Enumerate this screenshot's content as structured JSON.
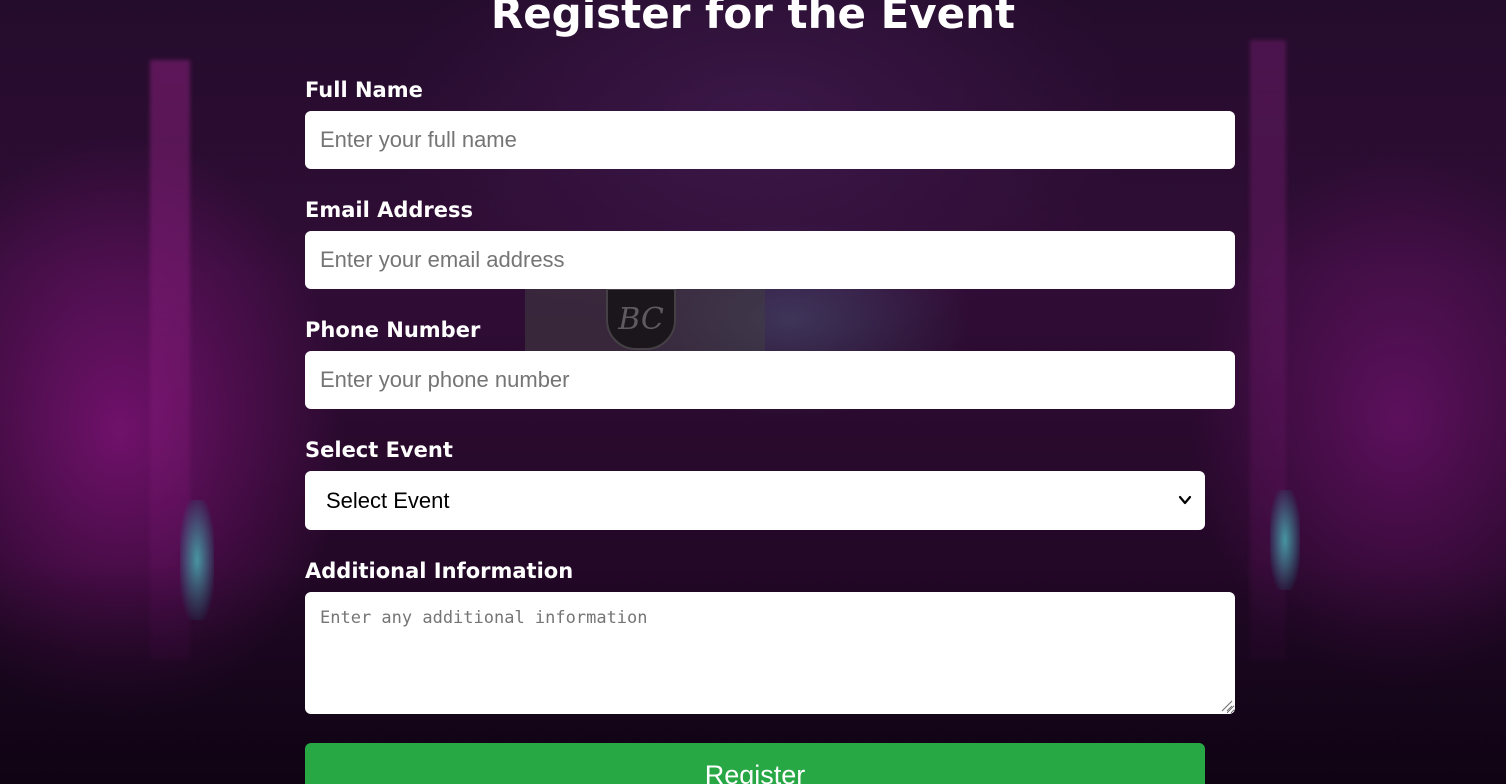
{
  "form": {
    "title": "Register for the Event",
    "full_name": {
      "label": "Full Name",
      "placeholder": "Enter your full name",
      "value": ""
    },
    "email": {
      "label": "Email Address",
      "placeholder": "Enter your email address",
      "value": ""
    },
    "phone": {
      "label": "Phone Number",
      "placeholder": "Enter your phone number",
      "value": ""
    },
    "event": {
      "label": "Select Event",
      "selected": "Select Event"
    },
    "additional": {
      "label": "Additional Information",
      "placeholder": "Enter any additional information",
      "value": ""
    },
    "submit_label": "Register"
  },
  "colors": {
    "submit_button": "#28a745",
    "input_background": "#ffffff",
    "label_text": "#ffffff"
  },
  "icons": {
    "select_chevron": "chevron-down-icon",
    "textarea_resize": "resize-handle-icon",
    "background_crest": "bc-crest-logo"
  },
  "background": {
    "crest_text": "BC"
  }
}
